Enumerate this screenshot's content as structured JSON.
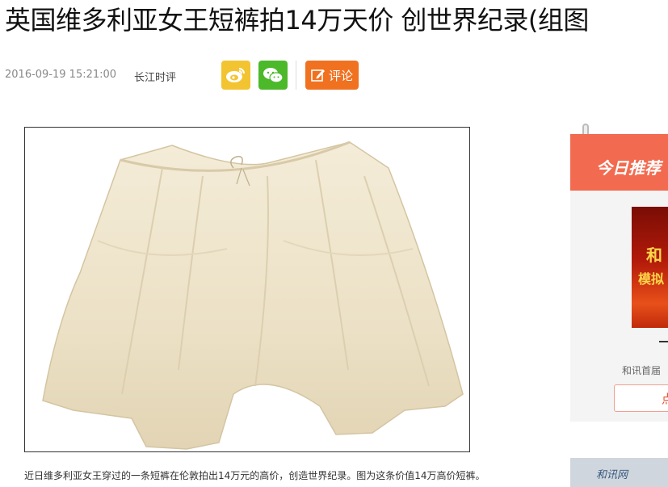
{
  "article": {
    "title": "英国维多利亚女王短裤拍14万天价 创世界纪录(组图",
    "date": "2016-09-19 15:21:00",
    "source": "长江时评",
    "comment_label": "评论",
    "caption": "近日维多利亚女王穿过的一条短裤在伦敦拍出14万元的高价，创造世界纪录。图为这条价值14万高价短裤。"
  },
  "share": {
    "weibo_icon": "weibo-icon",
    "wechat_icon": "wechat-icon",
    "comment_icon": "edit-icon"
  },
  "sidebar": {
    "recommend_title": "今日推荐",
    "ad_line1": "和",
    "ad_line2": "模拟",
    "ad_dash": "—",
    "desc": "和讯首届",
    "button_label": "点",
    "banner2_text": "和讯网"
  },
  "colors": {
    "weibo": "#f3c431",
    "wechat": "#4bb92a",
    "comment": "#f07120",
    "recommend_header": "#f26a4f"
  }
}
